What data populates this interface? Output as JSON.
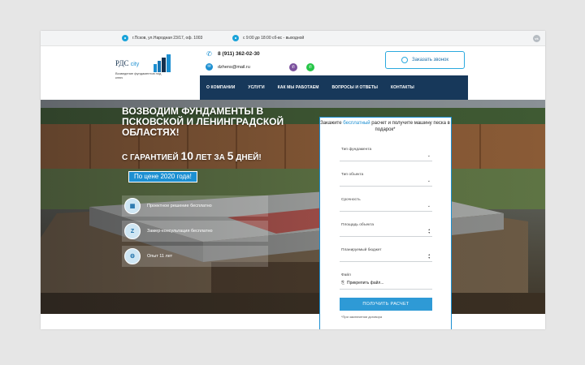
{
  "topbar": {
    "address": "г.Псков, ул.Народная 23/17, оф. 1003",
    "hours": "с 9:00 до 18:00 сб-вс - выходной",
    "vk_label": "vk"
  },
  "header": {
    "logo_main": "РДС",
    "logo_city": "city",
    "logo_sub": "Возведение фундаментов под ключ",
    "phone": "8 (911) 362-02-30",
    "email": "dzhens@mail.ru",
    "call_button": "Заказать звонок"
  },
  "nav": {
    "items": [
      {
        "label": "О КОМПАНИИ"
      },
      {
        "label": "УСЛУГИ"
      },
      {
        "label": "КАК МЫ РАБОТАЕМ"
      },
      {
        "label": "ВОПРОСЫ И ОТВЕТЫ"
      },
      {
        "label": "КОНТАКТЫ"
      }
    ]
  },
  "hero": {
    "title": "ВОЗВОДИМ ФУНДАМЕНТЫ В ПСКОВСКОЙ И ЛЕНИНГРАДСКОЙ ОБЛАСТЯХ!",
    "guarantee_prefix": "С ГАРАНТИЕЙ",
    "guarantee_years": "10",
    "guarantee_mid": "ЛЕТ ЗА",
    "guarantee_days": "5",
    "guarantee_suffix": "ДНЕЙ!",
    "price_badge": "По цене 2020 года!",
    "features": [
      {
        "label": "Проектное решение бесплатно",
        "icon": "blueprint-icon"
      },
      {
        "label": "Замер-консультация бесплатно",
        "icon": "zamer-icon"
      },
      {
        "label": "Опыт 11 лет",
        "icon": "gear-icon"
      }
    ]
  },
  "form": {
    "head_prefix": "Закажите",
    "head_highlight": "бесплатный",
    "head_rest": "расчет и получите машину песка в подарок*",
    "fields": [
      {
        "label": "Тип фундамента"
      },
      {
        "label": "Тип объекта"
      },
      {
        "label": "Срочность"
      },
      {
        "label": "Площадь объекта"
      },
      {
        "label": "Планируемый бюджет"
      },
      {
        "label": "Файл"
      }
    ],
    "attach_label": "Прикрепить файл...",
    "submit": "ПОЛУЧИТЬ РАСЧЕТ",
    "note": "*При заключении договора"
  },
  "colors": {
    "accent": "#1c8fd1",
    "nav_bg": "#17385a",
    "viber": "#7b519d",
    "whatsapp": "#25c547"
  }
}
